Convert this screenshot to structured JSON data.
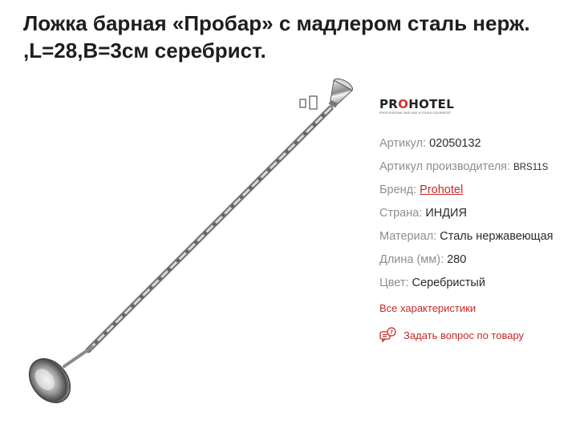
{
  "product": {
    "title": "Ложка барная «Пробар» с мадлером сталь нерж. ,L=28,B=3см серебрист."
  },
  "brand_logo": {
    "text_pre": "PR",
    "text_o": "O",
    "text_post": "HOTEL",
    "subtitle": "PROFESSIONAL BAR AND KITCHEN EQUIPMENT"
  },
  "specs": [
    {
      "label": "Артикул:",
      "value": "02050132"
    },
    {
      "label": "Артикул производителя:",
      "value": "BRS11S"
    },
    {
      "label": "Бренд:",
      "value": "Prohotel"
    },
    {
      "label": "Страна:",
      "value": "ИНДИЯ"
    },
    {
      "label": "Материал:",
      "value": "Сталь нержавеющая"
    },
    {
      "label": "Длина (мм):",
      "value": "280"
    },
    {
      "label": "Цвет:",
      "value": "Серебристый"
    }
  ],
  "links": {
    "all_specs": "Все характеристики",
    "ask_question": "Задать вопрос по товару"
  },
  "icons": {
    "gallery": "gallery-icon",
    "ask": "chat-question-icon"
  },
  "colors": {
    "accent": "#c62828",
    "label_gray": "#8e8e8e",
    "text": "#222222"
  }
}
